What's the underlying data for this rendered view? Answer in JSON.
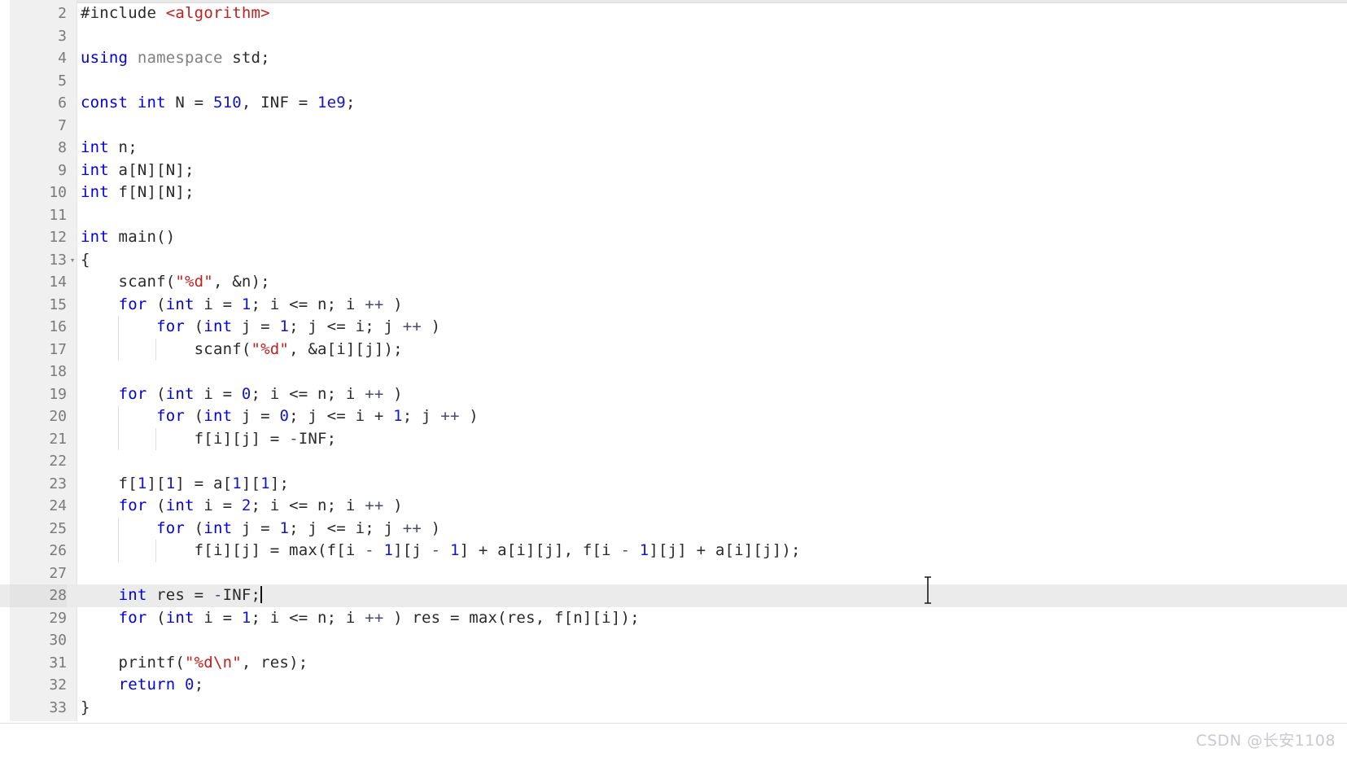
{
  "editor": {
    "language": "cpp",
    "first_visible_line": 2,
    "last_visible_line": 33,
    "active_line": 28,
    "colors": {
      "background": "#ffffff",
      "gutter_background": "#f0f0f0",
      "gutter_text": "#7a7a7a",
      "active_line_highlight": "#ebebeb",
      "keyword": "#0000e0",
      "number": "#1414c8",
      "string": "#c02020",
      "preprocessor": "#0000cc",
      "plain_text": "#2a2a2a",
      "operator": "#4a4a6a",
      "indent_guide": "#e0e0e0",
      "caret": "#111111",
      "watermark": "#c9c9cf"
    },
    "fold_marker_line": 13,
    "fold_marker_glyph": "▾",
    "caret_line": 28,
    "caret_column_after": "int res = -INF;"
  },
  "lines": [
    {
      "n": 2,
      "indent": 0,
      "guides": 0,
      "text": "#include <algorithm>"
    },
    {
      "n": 3,
      "indent": 0,
      "guides": 0,
      "text": ""
    },
    {
      "n": 4,
      "indent": 0,
      "guides": 0,
      "text": "using namespace std;"
    },
    {
      "n": 5,
      "indent": 0,
      "guides": 0,
      "text": ""
    },
    {
      "n": 6,
      "indent": 0,
      "guides": 0,
      "text": "const int N = 510, INF = 1e9;"
    },
    {
      "n": 7,
      "indent": 0,
      "guides": 0,
      "text": ""
    },
    {
      "n": 8,
      "indent": 0,
      "guides": 0,
      "text": "int n;"
    },
    {
      "n": 9,
      "indent": 0,
      "guides": 0,
      "text": "int a[N][N];"
    },
    {
      "n": 10,
      "indent": 0,
      "guides": 0,
      "text": "int f[N][N];"
    },
    {
      "n": 11,
      "indent": 0,
      "guides": 0,
      "text": ""
    },
    {
      "n": 12,
      "indent": 0,
      "guides": 0,
      "text": "int main()"
    },
    {
      "n": 13,
      "indent": 0,
      "guides": 0,
      "text": "{"
    },
    {
      "n": 14,
      "indent": 1,
      "guides": 0,
      "text": "    scanf(\"%d\", &n);"
    },
    {
      "n": 15,
      "indent": 1,
      "guides": 0,
      "text": "    for (int i = 1; i <= n; i ++ )"
    },
    {
      "n": 16,
      "indent": 2,
      "guides": 1,
      "text": "        for (int j = 1; j <= i; j ++ )"
    },
    {
      "n": 17,
      "indent": 3,
      "guides": 2,
      "text": "            scanf(\"%d\", &a[i][j]);"
    },
    {
      "n": 18,
      "indent": 0,
      "guides": 0,
      "text": ""
    },
    {
      "n": 19,
      "indent": 1,
      "guides": 0,
      "text": "    for (int i = 0; i <= n; i ++ )"
    },
    {
      "n": 20,
      "indent": 2,
      "guides": 1,
      "text": "        for (int j = 0; j <= i + 1; j ++ )"
    },
    {
      "n": 21,
      "indent": 3,
      "guides": 2,
      "text": "            f[i][j] = -INF;"
    },
    {
      "n": 22,
      "indent": 0,
      "guides": 0,
      "text": ""
    },
    {
      "n": 23,
      "indent": 1,
      "guides": 0,
      "text": "    f[1][1] = a[1][1];"
    },
    {
      "n": 24,
      "indent": 1,
      "guides": 0,
      "text": "    for (int i = 2; i <= n; i ++ )"
    },
    {
      "n": 25,
      "indent": 2,
      "guides": 1,
      "text": "        for (int j = 1; j <= i; j ++ )"
    },
    {
      "n": 26,
      "indent": 3,
      "guides": 2,
      "text": "            f[i][j] = max(f[i - 1][j - 1] + a[i][j], f[i - 1][j] + a[i][j]);"
    },
    {
      "n": 27,
      "indent": 0,
      "guides": 0,
      "text": ""
    },
    {
      "n": 28,
      "indent": 1,
      "guides": 0,
      "text": "    int res = -INF;"
    },
    {
      "n": 29,
      "indent": 1,
      "guides": 0,
      "text": "    for (int i = 1; i <= n; i ++ ) res = max(res, f[n][i]);"
    },
    {
      "n": 30,
      "indent": 0,
      "guides": 0,
      "text": ""
    },
    {
      "n": 31,
      "indent": 1,
      "guides": 0,
      "text": "    printf(\"%d\\n\", res);"
    },
    {
      "n": 32,
      "indent": 1,
      "guides": 0,
      "text": "    return 0;"
    },
    {
      "n": 33,
      "indent": 0,
      "guides": 0,
      "text": "}"
    }
  ],
  "tokens": {
    "2": [
      [
        "plain",
        "#include "
      ],
      [
        "hdr",
        "<algorithm>"
      ]
    ],
    "4": [
      [
        "kw",
        "using "
      ],
      [
        "dim",
        "namespace "
      ],
      [
        "plain",
        "std;"
      ]
    ],
    "6": [
      [
        "kw",
        "const"
      ],
      [
        "plain",
        " "
      ],
      [
        "kw",
        "int"
      ],
      [
        "plain",
        " N = "
      ],
      [
        "num",
        "510"
      ],
      [
        "plain",
        ", INF = "
      ],
      [
        "num",
        "1e9"
      ],
      [
        "plain",
        ";"
      ]
    ],
    "8": [
      [
        "kw",
        "int"
      ],
      [
        "plain",
        " n;"
      ]
    ],
    "9": [
      [
        "kw",
        "int"
      ],
      [
        "plain",
        " a[N][N];"
      ]
    ],
    "10": [
      [
        "kw",
        "int"
      ],
      [
        "plain",
        " f[N][N];"
      ]
    ],
    "12": [
      [
        "kw",
        "int"
      ],
      [
        "plain",
        " main()"
      ]
    ],
    "13": [
      [
        "plain",
        "{"
      ]
    ],
    "14": [
      [
        "plain",
        "    scanf("
      ],
      [
        "str",
        "\"%d\""
      ],
      [
        "plain",
        ", &n);"
      ]
    ],
    "15": [
      [
        "plain",
        "    "
      ],
      [
        "kw",
        "for"
      ],
      [
        "plain",
        " ("
      ],
      [
        "kw",
        "int"
      ],
      [
        "plain",
        " i = "
      ],
      [
        "num",
        "1"
      ],
      [
        "plain",
        "; i <= n; i "
      ],
      [
        "op",
        "++"
      ],
      [
        "plain",
        " )"
      ]
    ],
    "16": [
      [
        "plain",
        "        "
      ],
      [
        "kw",
        "for"
      ],
      [
        "plain",
        " ("
      ],
      [
        "kw",
        "int"
      ],
      [
        "plain",
        " j = "
      ],
      [
        "num",
        "1"
      ],
      [
        "plain",
        "; j <= i; j "
      ],
      [
        "op",
        "++"
      ],
      [
        "plain",
        " )"
      ]
    ],
    "17": [
      [
        "plain",
        "            scanf("
      ],
      [
        "str",
        "\"%d\""
      ],
      [
        "plain",
        ", &a[i][j]);"
      ]
    ],
    "19": [
      [
        "plain",
        "    "
      ],
      [
        "kw",
        "for"
      ],
      [
        "plain",
        " ("
      ],
      [
        "kw",
        "int"
      ],
      [
        "plain",
        " i = "
      ],
      [
        "num",
        "0"
      ],
      [
        "plain",
        "; i <= n; i "
      ],
      [
        "op",
        "++"
      ],
      [
        "plain",
        " )"
      ]
    ],
    "20": [
      [
        "plain",
        "        "
      ],
      [
        "kw",
        "for"
      ],
      [
        "plain",
        " ("
      ],
      [
        "kw",
        "int"
      ],
      [
        "plain",
        " j = "
      ],
      [
        "num",
        "0"
      ],
      [
        "plain",
        "; j <= i + "
      ],
      [
        "num",
        "1"
      ],
      [
        "plain",
        "; j "
      ],
      [
        "op",
        "++"
      ],
      [
        "plain",
        " )"
      ]
    ],
    "21": [
      [
        "plain",
        "            f[i][j] = "
      ],
      [
        "op",
        "-"
      ],
      [
        "plain",
        "INF;"
      ]
    ],
    "23": [
      [
        "plain",
        "    f["
      ],
      [
        "num",
        "1"
      ],
      [
        "plain",
        "]["
      ],
      [
        "num",
        "1"
      ],
      [
        "plain",
        "] = a["
      ],
      [
        "num",
        "1"
      ],
      [
        "plain",
        "]["
      ],
      [
        "num",
        "1"
      ],
      [
        "plain",
        "];"
      ]
    ],
    "24": [
      [
        "plain",
        "    "
      ],
      [
        "kw",
        "for"
      ],
      [
        "plain",
        " ("
      ],
      [
        "kw",
        "int"
      ],
      [
        "plain",
        " i = "
      ],
      [
        "num",
        "2"
      ],
      [
        "plain",
        "; i <= n; i "
      ],
      [
        "op",
        "++"
      ],
      [
        "plain",
        " )"
      ]
    ],
    "25": [
      [
        "plain",
        "        "
      ],
      [
        "kw",
        "for"
      ],
      [
        "plain",
        " ("
      ],
      [
        "kw",
        "int"
      ],
      [
        "plain",
        " j = "
      ],
      [
        "num",
        "1"
      ],
      [
        "plain",
        "; j <= i; j "
      ],
      [
        "op",
        "++"
      ],
      [
        "plain",
        " )"
      ]
    ],
    "26": [
      [
        "plain",
        "            f[i][j] = max(f[i "
      ],
      [
        "op",
        "-"
      ],
      [
        "plain",
        " "
      ],
      [
        "num",
        "1"
      ],
      [
        "plain",
        "][j "
      ],
      [
        "op",
        "-"
      ],
      [
        "plain",
        " "
      ],
      [
        "num",
        "1"
      ],
      [
        "plain",
        "] + a[i][j], f[i "
      ],
      [
        "op",
        "-"
      ],
      [
        "plain",
        " "
      ],
      [
        "num",
        "1"
      ],
      [
        "plain",
        "][j] + a[i][j]);"
      ]
    ],
    "28": [
      [
        "plain",
        "    "
      ],
      [
        "kw",
        "int"
      ],
      [
        "plain",
        " res = "
      ],
      [
        "op",
        "-"
      ],
      [
        "plain",
        "INF;"
      ]
    ],
    "29": [
      [
        "plain",
        "    "
      ],
      [
        "kw",
        "for"
      ],
      [
        "plain",
        " ("
      ],
      [
        "kw",
        "int"
      ],
      [
        "plain",
        " i = "
      ],
      [
        "num",
        "1"
      ],
      [
        "plain",
        "; i <= n; i "
      ],
      [
        "op",
        "++"
      ],
      [
        "plain",
        " ) res = max(res, f[n][i]);"
      ]
    ],
    "31": [
      [
        "plain",
        "    printf("
      ],
      [
        "str",
        "\"%d\\n\""
      ],
      [
        "plain",
        ", res);"
      ]
    ],
    "32": [
      [
        "plain",
        "    "
      ],
      [
        "kw",
        "return"
      ],
      [
        "plain",
        " "
      ],
      [
        "num",
        "0"
      ],
      [
        "plain",
        ";"
      ]
    ],
    "33": [
      [
        "plain",
        "}"
      ]
    ]
  },
  "watermark": {
    "text": "CSDN @长安1108"
  }
}
